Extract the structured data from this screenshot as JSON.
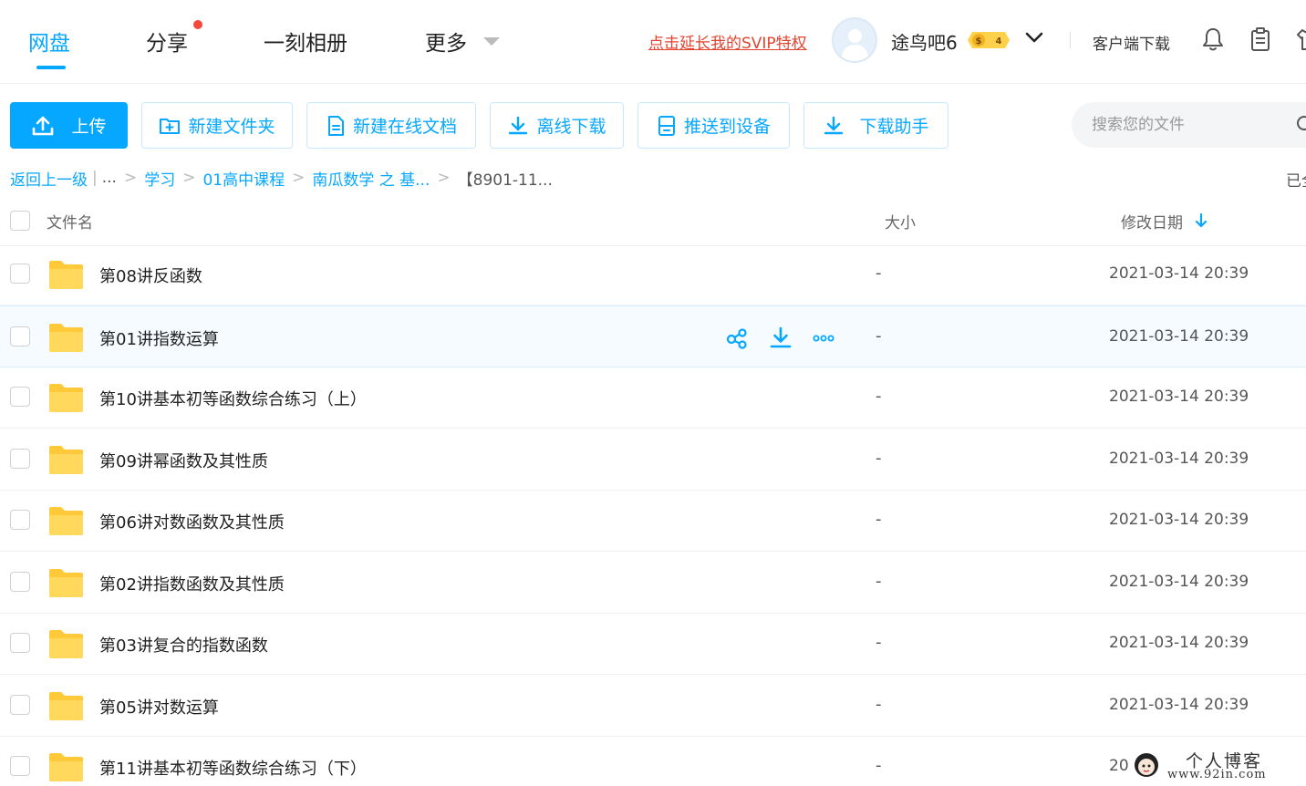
{
  "nav": {
    "tabs": [
      {
        "label": "网盘",
        "active": true
      },
      {
        "label": "分享",
        "has_dot": true
      },
      {
        "label": "一刻相册"
      },
      {
        "label": "更多",
        "has_caret": true
      }
    ],
    "svip_link": "点击延长我的SVIP特权",
    "username": "途鸟吧6",
    "vip_level": "4",
    "client_download": "客户端下载",
    "icons": [
      "bell-icon",
      "clipboard-icon",
      "shirt-icon"
    ]
  },
  "toolbar": {
    "upload": "上传",
    "new_folder": "新建文件夹",
    "new_doc": "新建在线文档",
    "offline_download": "离线下载",
    "push_device": "推送到设备",
    "download_helper": "下载助手"
  },
  "search": {
    "placeholder": "搜索您的文件"
  },
  "breadcrumb": {
    "back": "返回上一级",
    "ellipsis": "...",
    "items": [
      "学习",
      "01高中课程",
      "南瓜数学 之 基..."
    ],
    "current": "【8901-11...",
    "right_text": "已全"
  },
  "table": {
    "headers": {
      "name": "文件名",
      "size": "大小",
      "date": "修改日期"
    },
    "rows": [
      {
        "name": "第08讲反函数",
        "size": "-",
        "date": "2021-03-14 20:39"
      },
      {
        "name": "第01讲指数运算",
        "size": "-",
        "date": "2021-03-14 20:39",
        "hover": true
      },
      {
        "name": "第10讲基本初等函数综合练习（上）",
        "size": "-",
        "date": "2021-03-14 20:39"
      },
      {
        "name": "第09讲幂函数及其性质",
        "size": "-",
        "date": "2021-03-14 20:39"
      },
      {
        "name": "第06讲对数函数及其性质",
        "size": "-",
        "date": "2021-03-14 20:39"
      },
      {
        "name": "第02讲指数函数及其性质",
        "size": "-",
        "date": "2021-03-14 20:39"
      },
      {
        "name": "第03讲复合的指数函数",
        "size": "-",
        "date": "2021-03-14 20:39"
      },
      {
        "name": "第05讲对数运算",
        "size": "-",
        "date": "2021-03-14 20:39"
      },
      {
        "name": "第11讲基本初等函数综合练习（下）",
        "size": "-",
        "date": "20"
      }
    ]
  },
  "watermark": {
    "title": "个人博客",
    "url": "www.92in.com"
  },
  "colors": {
    "accent": "#06a7ff",
    "svip": "#e3432f",
    "folder": "#ffd452"
  }
}
